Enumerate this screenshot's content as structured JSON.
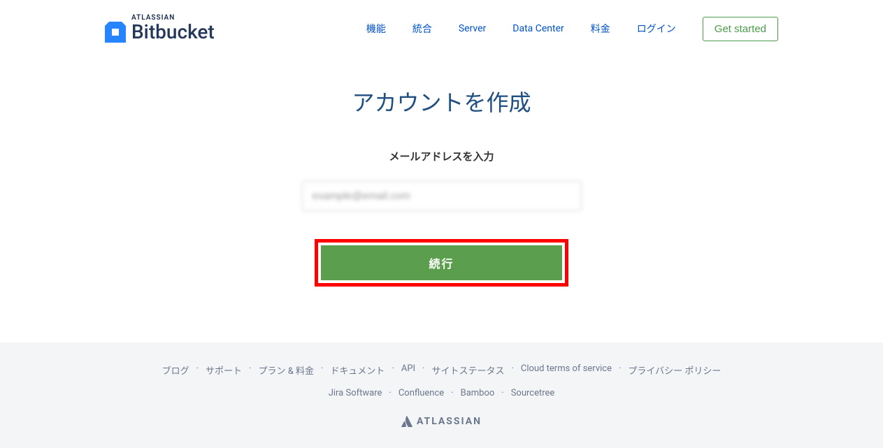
{
  "header": {
    "atlassian_label": "ATLASSIAN",
    "brand": "Bitbucket",
    "nav": {
      "features": "機能",
      "integrations": "統合",
      "server": "Server",
      "data_center": "Data Center",
      "pricing": "料金",
      "login": "ログイン",
      "get_started": "Get started"
    }
  },
  "main": {
    "title": "アカウントを作成",
    "subtitle": "メールアドレスを入力",
    "email_value": "example@email.com",
    "continue_label": "続行"
  },
  "footer": {
    "links_row1": {
      "blog": "ブログ",
      "support": "サポート",
      "plans": "プラン & 料金",
      "docs": "ドキュメント",
      "api": "API",
      "status": "サイトステータス",
      "terms": "Cloud terms of service",
      "privacy": "プライバシー ポリシー"
    },
    "links_row2": {
      "jira": "Jira Software",
      "confluence": "Confluence",
      "bamboo": "Bamboo",
      "sourcetree": "Sourcetree"
    },
    "atlassian": "ATLASSIAN"
  }
}
